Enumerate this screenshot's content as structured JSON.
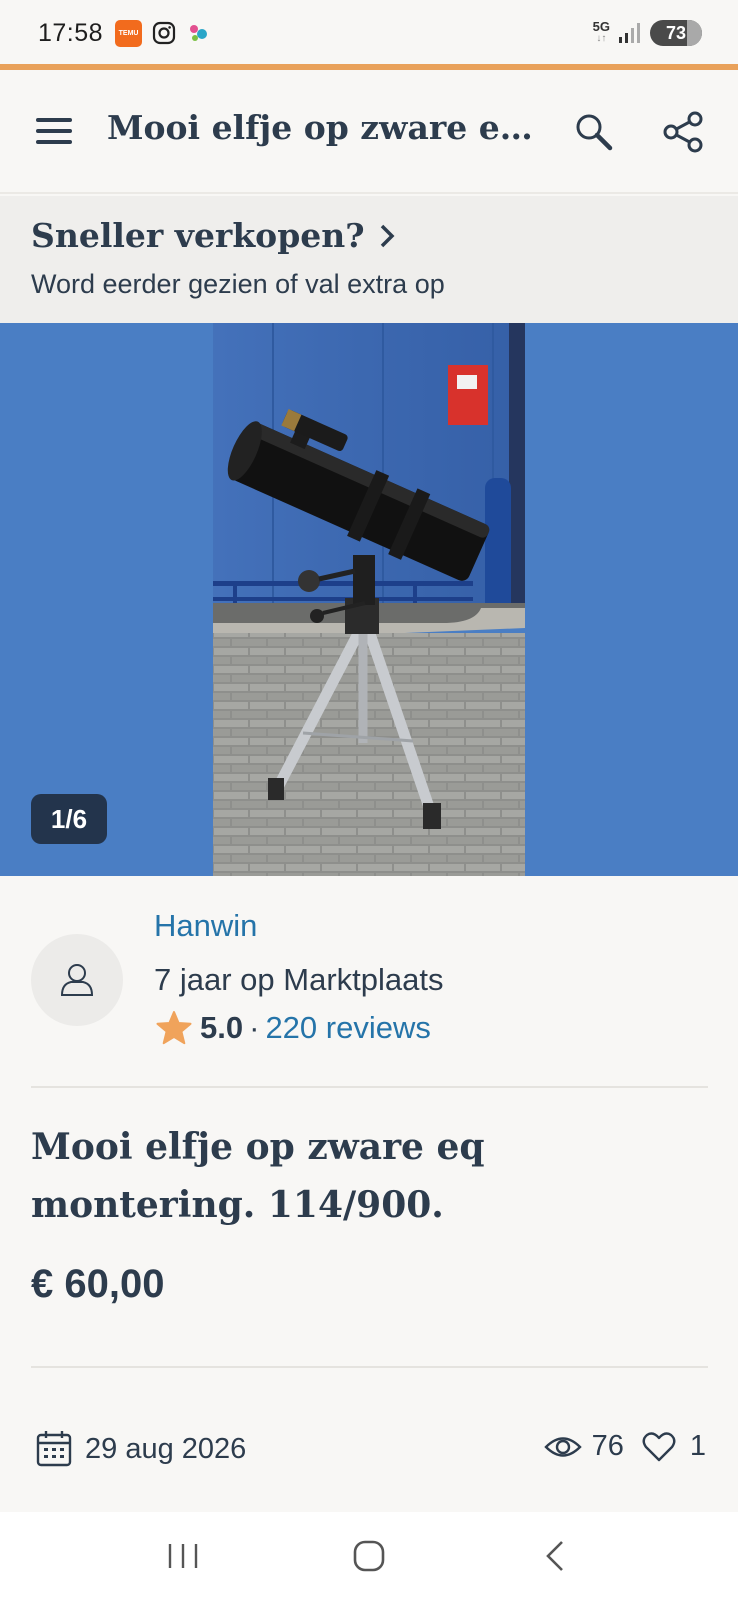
{
  "status_bar": {
    "time": "17:58",
    "network": "5G",
    "battery": "73",
    "notification_icons": [
      "temu-app-icon",
      "instagram-icon",
      "assistant-app-icon"
    ],
    "temu_label": "TEMU"
  },
  "header": {
    "title": "Mooi elfje op zware eq montering. 114/900.",
    "icons": [
      "menu-icon",
      "search-icon",
      "share-icon"
    ]
  },
  "promo": {
    "title": "Sneller verkopen?",
    "subtitle": "Word eerder gezien of val extra op"
  },
  "gallery": {
    "counter": "1/6",
    "background_color": "#4a7ec4"
  },
  "seller": {
    "name": "Hanwin",
    "years": "7 jaar op Marktplaats",
    "rating": "5.0",
    "separator": "·",
    "reviews": "220 reviews"
  },
  "listing": {
    "title": "Mooi elfje op zware eq montering. 114/900.",
    "price": "€ 60,00"
  },
  "meta": {
    "date": "29 aug 2026",
    "views": "76",
    "favorites": "1"
  },
  "colors": {
    "accent": "#e9a15a",
    "link": "#2574a9",
    "text": "#2d3c4d",
    "star": "#f0a35b"
  }
}
